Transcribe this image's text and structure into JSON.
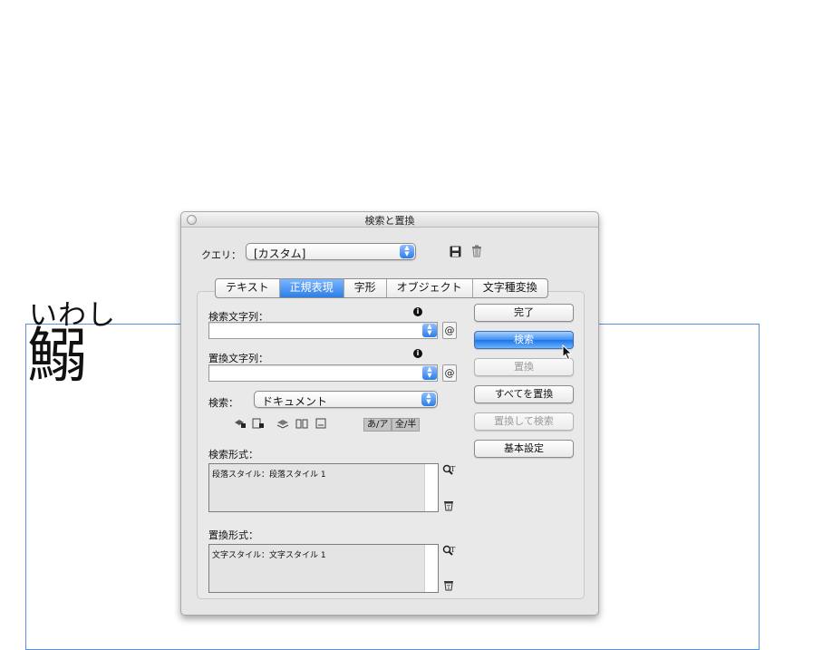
{
  "document": {
    "ruby_text": "いわし",
    "kanji_text": "鰯"
  },
  "dialog": {
    "title": "検索と置換",
    "query": {
      "label": "クエリ：",
      "value": "[カスタム]",
      "save_icon": "disk-icon",
      "delete_icon": "trash-icon"
    },
    "tabs": [
      {
        "label": "テキスト",
        "active": false
      },
      {
        "label": "正規表現",
        "active": true
      },
      {
        "label": "字形",
        "active": false
      },
      {
        "label": "オブジェクト",
        "active": false
      },
      {
        "label": "文字種変換",
        "active": false
      }
    ],
    "find_field": {
      "label": "検索文字列：",
      "value": ""
    },
    "replace_field": {
      "label": "置換文字列：",
      "value": ""
    },
    "at_symbol": "@",
    "search_scope": {
      "label": "検索：",
      "value": "ドキュメント"
    },
    "option_toggles": [
      "あ/ア",
      "全/半"
    ],
    "find_format": {
      "label": "検索形式：",
      "value": "段落スタイル：段落スタイル 1"
    },
    "replace_format": {
      "label": "置換形式：",
      "value": "文字スタイル：文字スタイル 1"
    },
    "buttons": {
      "done": "完了",
      "find": "検索",
      "replace": "置換",
      "replace_all": "すべてを置換",
      "replace_find": "置換して検索",
      "basic_settings": "基本設定"
    },
    "colors": {
      "accent": "#2e7ee6",
      "frame": "#5c8fd9"
    }
  }
}
